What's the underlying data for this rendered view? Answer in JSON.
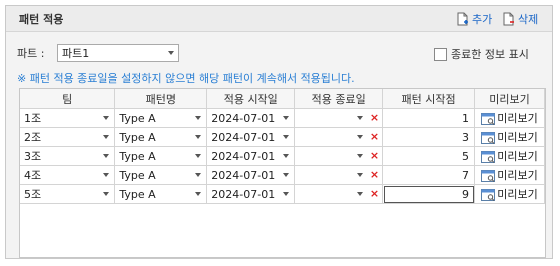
{
  "panel": {
    "title": "패턴 적용",
    "add_label": "추가",
    "delete_label": "삭제"
  },
  "part": {
    "label": "파트 :",
    "selected": "파트1"
  },
  "show_ended_label": "종료한 정보 표시",
  "notice": "※ 패턴 적용 종료일을 설정하지 않으면 해당 패턴이 계속해서 적용됩니다.",
  "table": {
    "headers": [
      "팀",
      "패턴명",
      "적용 시작일",
      "적용 종료일",
      "패턴 시작점",
      "미리보기"
    ],
    "rows": [
      {
        "team": "1조",
        "pattern": "Type A",
        "start": "2024-07-01",
        "end": "",
        "start_point": "1",
        "preview": "미리보기"
      },
      {
        "team": "2조",
        "pattern": "Type A",
        "start": "2024-07-01",
        "end": "",
        "start_point": "3",
        "preview": "미리보기"
      },
      {
        "team": "3조",
        "pattern": "Type A",
        "start": "2024-07-01",
        "end": "",
        "start_point": "5",
        "preview": "미리보기"
      },
      {
        "team": "4조",
        "pattern": "Type A",
        "start": "2024-07-01",
        "end": "",
        "start_point": "7",
        "preview": "미리보기"
      },
      {
        "team": "5조",
        "pattern": "Type A",
        "start": "2024-07-01",
        "end": "",
        "start_point": "9",
        "preview": "미리보기"
      }
    ],
    "clear_mark": "×"
  },
  "colors": {
    "link": "#1a66c7",
    "notice": "#2a7fd4",
    "clear": "#d22222"
  }
}
